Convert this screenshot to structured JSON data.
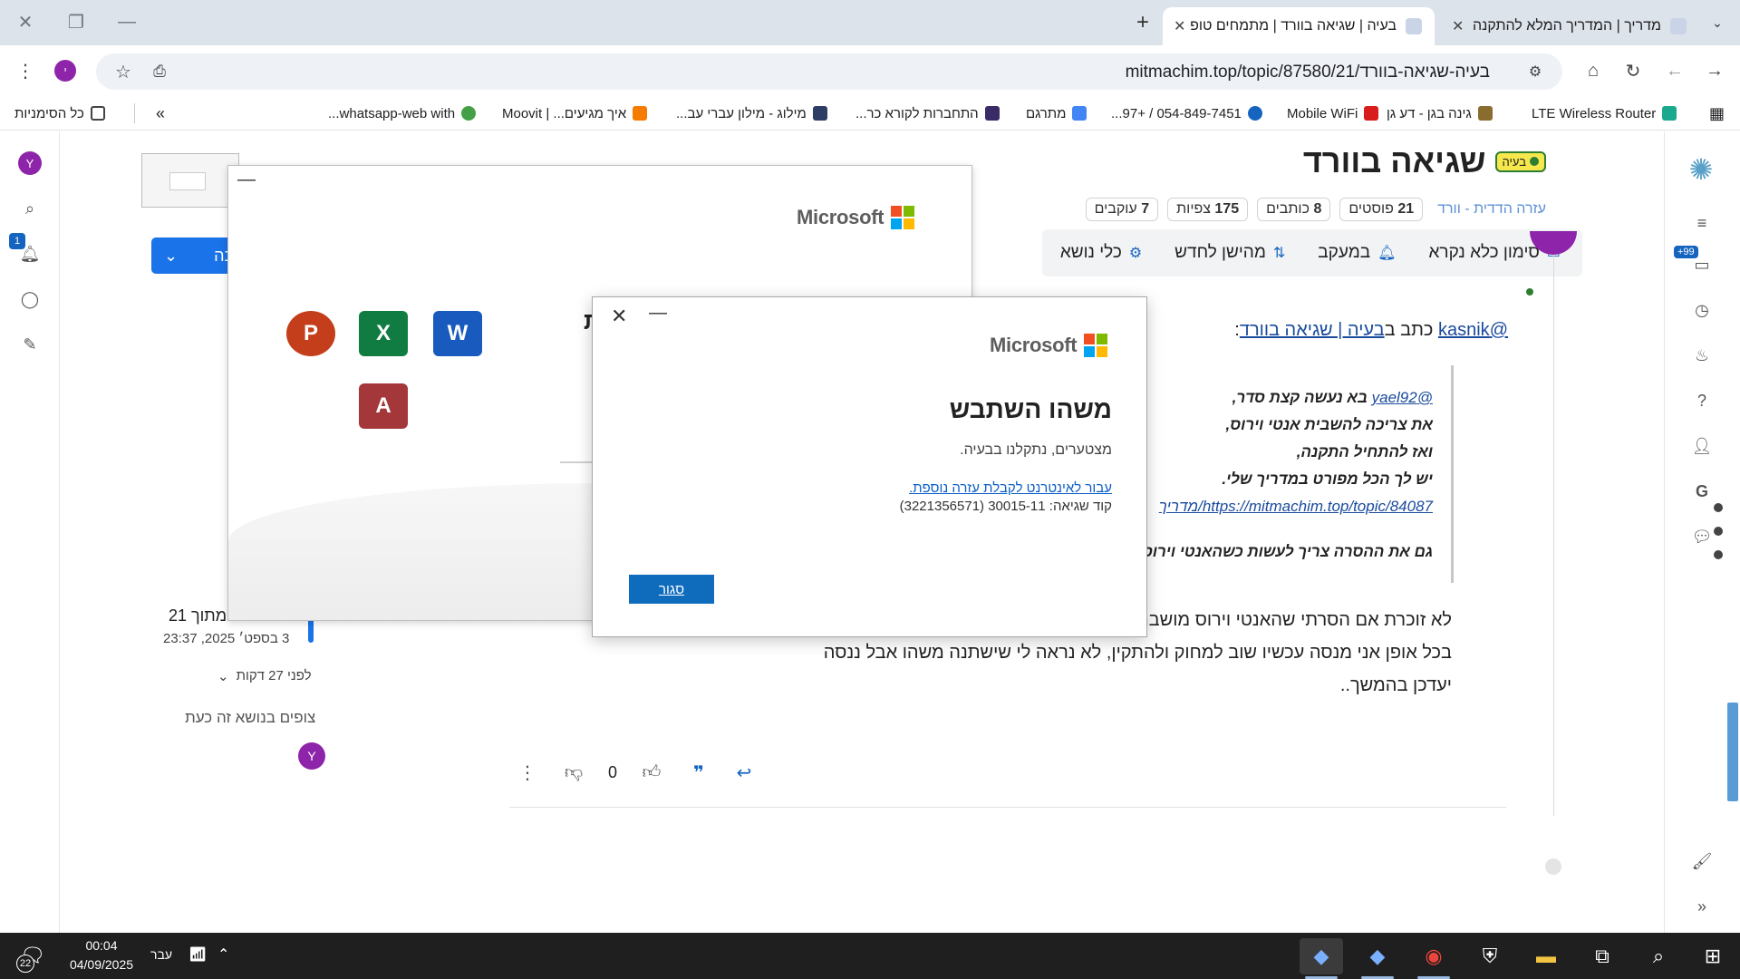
{
  "browser": {
    "tabs": [
      {
        "title": "מדריך | המדריך המלא להתקנה",
        "active": false
      },
      {
        "title": "בעיה | שגיאה בוורד | מתמחים טופ",
        "active": true
      }
    ],
    "address": "mitmachim.top/topic/87580/21/בעיה-שגיאה-בוורד",
    "profile_letter": "י"
  },
  "bookmarks": {
    "items": [
      "LTE Wireless Router",
      "גינה בגן - דע גן",
      "Mobile WiFi",
      "054-849-7451 / +97...",
      "מתרגם",
      "התחברות לקורא כר...",
      "מילוג - מילון עברי עב...",
      "איך מגיעים... | Moovit",
      "whatsapp-web with..."
    ],
    "all_bookmarks": "כל הסימניות",
    "overflow": "»"
  },
  "topic": {
    "title": "שגיאה בוורד",
    "tag": "בעיה",
    "category": "עזרה הדדית - וורד",
    "stats": [
      {
        "num": "21",
        "label": "פוסטים"
      },
      {
        "num": "8",
        "label": "כותבים"
      },
      {
        "num": "175",
        "label": "צפיות"
      },
      {
        "num": "7",
        "label": "עוקבים"
      }
    ],
    "tools": {
      "mark_read": "סימון כלא נקרא",
      "watching": "במעקב",
      "sort": "מהישן לחדש",
      "topic_tools": "כלי נושא"
    },
    "reply_label": "תגובה",
    "notifications_count": "1",
    "unread_badge": "+99",
    "user_letter": "Y"
  },
  "post": {
    "quote_intro": {
      "user": "@kasnik",
      "wrote_in": "כתב ב",
      "topic_link": "בעיה | שגיאה בוורד",
      "colon": ":"
    },
    "quote_lines": {
      "mention": "@yael92",
      "l1": " בא נעשה קצת סדר,",
      "l2": "את צריכה להשבית אנטי וירוס,",
      "l3": "ואז להתחיל התקנה,",
      "l4": "יש לך הכל מפורט במדריך שלי.",
      "link": "https://mitmachim.top/topic/84087/מדריך",
      "l6": "גם את ההסרה צריך לעשות כשהאנטי וירוס מושבת"
    },
    "body": {
      "l1": "לא זוכרת אם הסרתי שהאנטי וירוס מושבת",
      "l2": "בכל אופן אני מנסה עכשיו שוב למחוק ולהתקין, לא נראה לי שישתנה משהו אבל ננסה",
      "l3": "יעדכן בהמשך.."
    },
    "votes": "0",
    "counter": "פוסט 21 מתוך 21",
    "date": "3 בספט׳ 2025, 23:37",
    "ago": "לפני 27 דקות",
    "watching_now": "צופים בנושא זה כעת",
    "watcher_letter": "Y"
  },
  "office_installer": {
    "brand": "Microsoft",
    "apps": [
      "P",
      "X",
      "W",
      "A"
    ],
    "partial_heading": "ת"
  },
  "error_dialog": {
    "brand": "Microsoft",
    "title": "משהו השתבש",
    "subtitle": "מצטערים, נתקלנו בבעיה.",
    "help_link": "עבור לאינטרנט לקבלת עזרה נוספת.",
    "error_code": "קוד שגיאה: 30015-11 (3221356571)",
    "close_button": "סגור"
  },
  "taskbar": {
    "time": "00:04",
    "date": "04/09/2025",
    "language": "עבר",
    "notification_count": "22"
  },
  "colors": {
    "accent": "#1a73e8",
    "office_button": "#0f6cbd",
    "tag_bg": "#f6e84c",
    "avatar": "#8e24aa"
  }
}
